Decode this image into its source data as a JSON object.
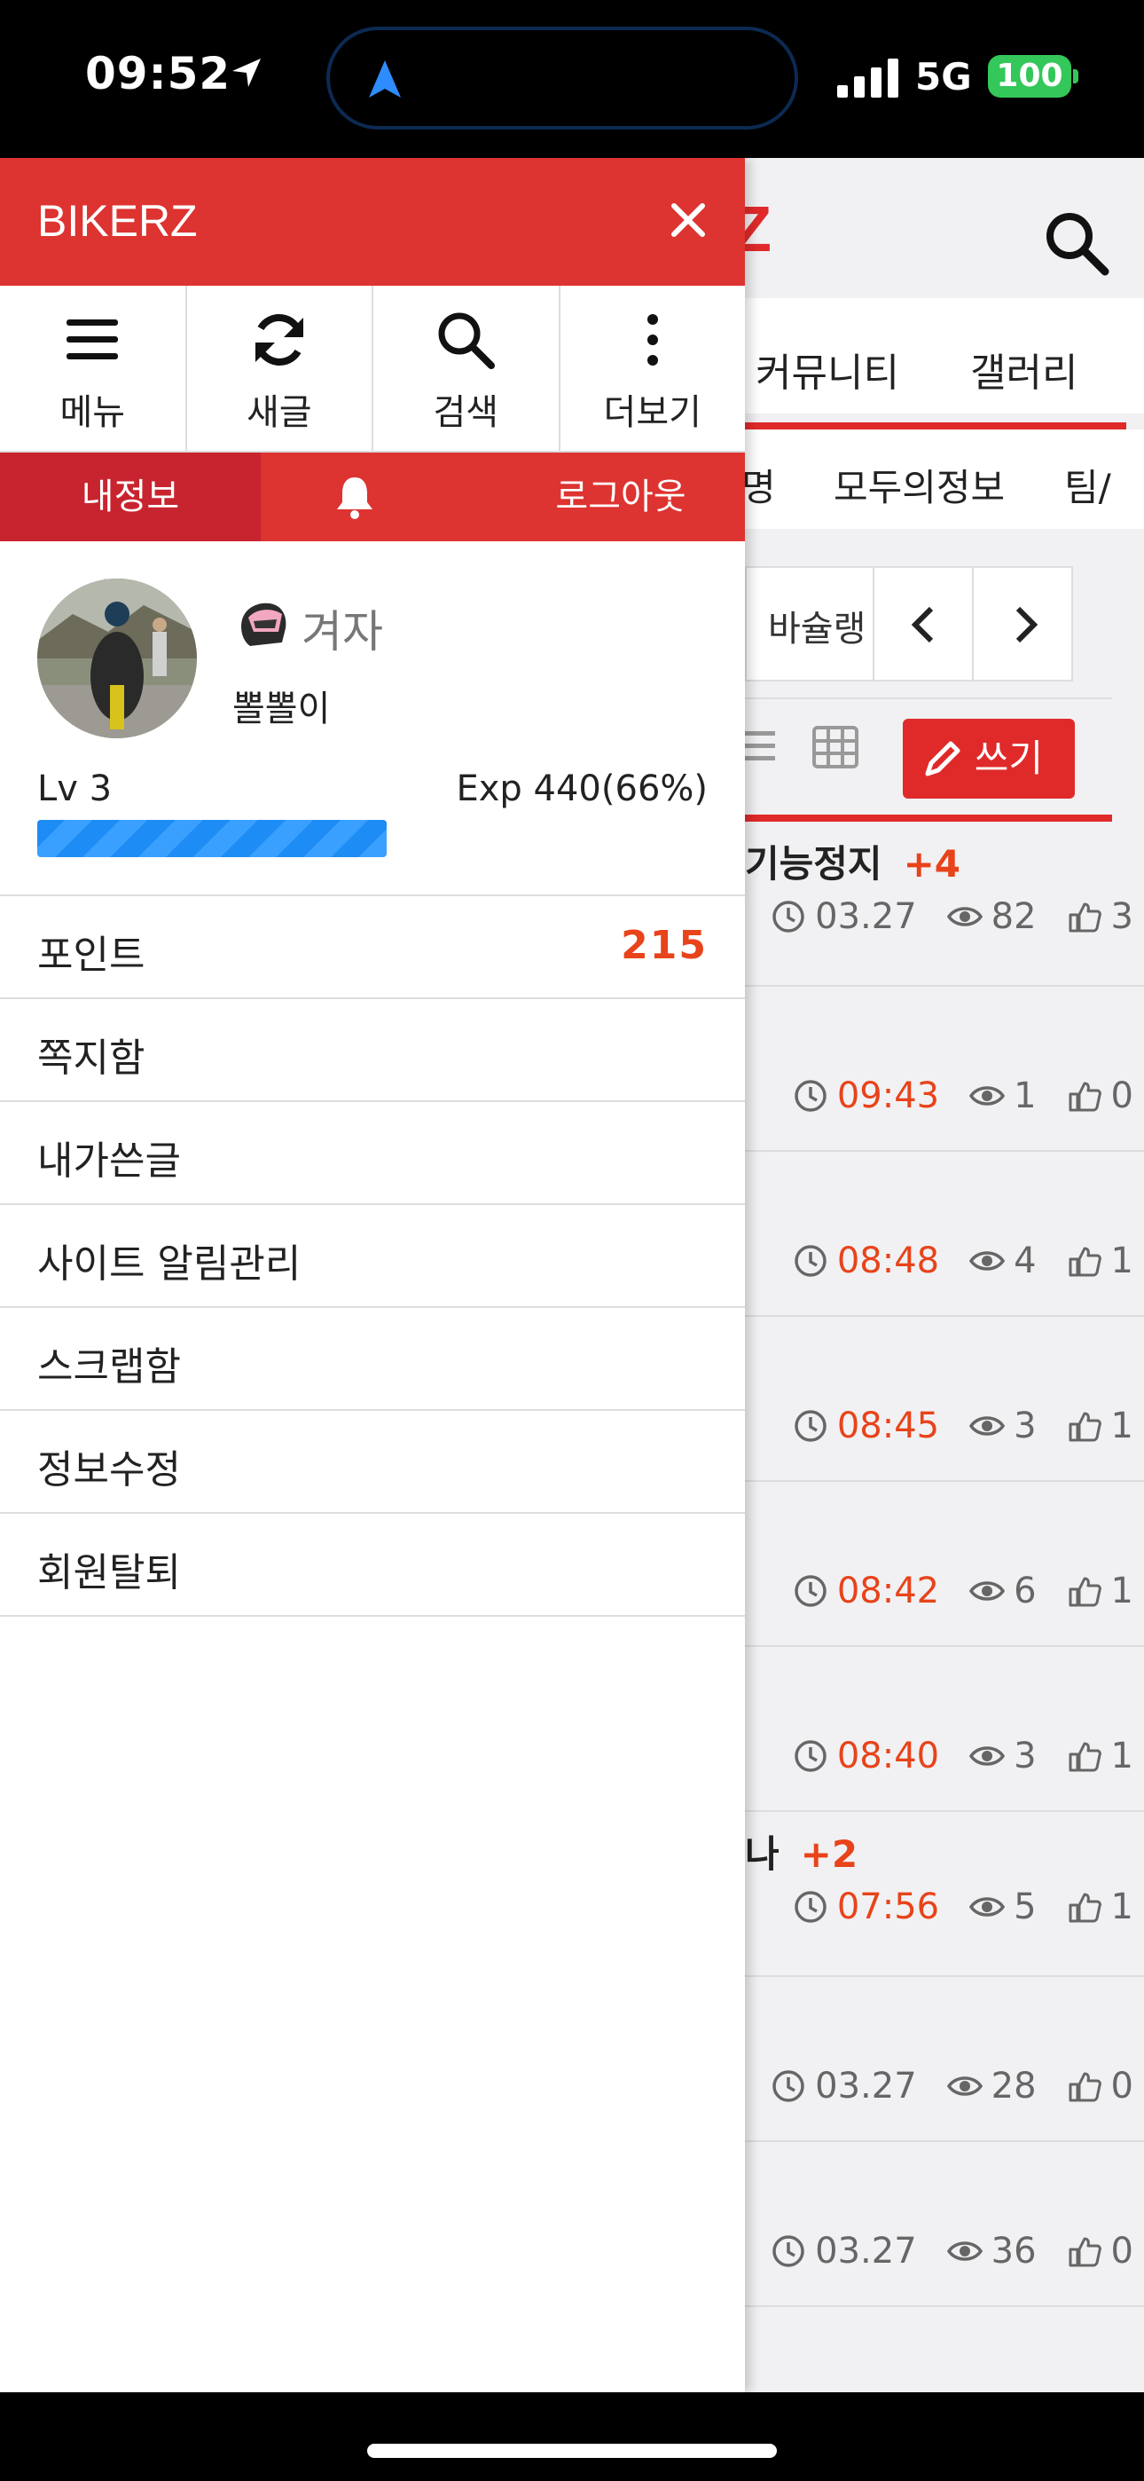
{
  "status": {
    "time": "09:52",
    "network": "5G",
    "battery": "100",
    "icons": [
      "location-arrow-icon",
      "navigation-arrow-icon",
      "signal-bars-icon",
      "battery-icon"
    ]
  },
  "background": {
    "logo_fragment": "Z",
    "nav": [
      "커뮤니티",
      "갤러리"
    ],
    "subnav": [
      "명",
      "모두의정보",
      "팀/"
    ],
    "filter_label": "바슐랭",
    "write_label": "쓰기",
    "posts": [
      {
        "title": "기능정지",
        "plus": "+4",
        "time": "03.27",
        "views": "82",
        "likes": "3",
        "recent": false
      },
      {
        "title": "",
        "plus": "",
        "time": "09:43",
        "views": "1",
        "likes": "0",
        "recent": true
      },
      {
        "title": "",
        "plus": "",
        "time": "08:48",
        "views": "4",
        "likes": "1",
        "recent": true
      },
      {
        "title": "",
        "plus": "",
        "time": "08:45",
        "views": "3",
        "likes": "1",
        "recent": true
      },
      {
        "title": "",
        "plus": "",
        "time": "08:42",
        "views": "6",
        "likes": "1",
        "recent": true
      },
      {
        "title": "",
        "plus": "",
        "time": "08:40",
        "views": "3",
        "likes": "1",
        "recent": true
      },
      {
        "title": "나",
        "plus": "+2",
        "time": "07:56",
        "views": "5",
        "likes": "1",
        "recent": true
      },
      {
        "title": "",
        "plus": "",
        "time": "03.27",
        "views": "28",
        "likes": "0",
        "recent": false
      },
      {
        "title": "",
        "plus": "",
        "time": "03.27",
        "views": "36",
        "likes": "0",
        "recent": false
      }
    ]
  },
  "drawer": {
    "title": "BIKERZ",
    "quick": [
      {
        "label": "메뉴",
        "icon": "hamburger-menu-icon"
      },
      {
        "label": "새글",
        "icon": "refresh-icon"
      },
      {
        "label": "검색",
        "icon": "search-icon"
      },
      {
        "label": "더보기",
        "icon": "more-vertical-icon"
      }
    ],
    "tabs": {
      "my": "내정보",
      "logout": "로그아웃"
    },
    "profile": {
      "rank": "겨자",
      "nickname": "뽈뽈이",
      "level": "Lv 3",
      "exp": "Exp 440(66%)",
      "exp_fraction": 0.66
    },
    "menu": [
      {
        "label": "포인트",
        "value": "215"
      },
      {
        "label": "쪽지함",
        "value": ""
      },
      {
        "label": "내가쓴글",
        "value": ""
      },
      {
        "label": "사이트 알림관리",
        "value": ""
      },
      {
        "label": "스크랩함",
        "value": ""
      },
      {
        "label": "정보수정",
        "value": ""
      },
      {
        "label": "회원탈퇴",
        "value": ""
      }
    ]
  },
  "colors": {
    "brand_red": "#dd3331",
    "accent_orange": "#e8431a",
    "progress_blue": "#1e8cf5"
  }
}
